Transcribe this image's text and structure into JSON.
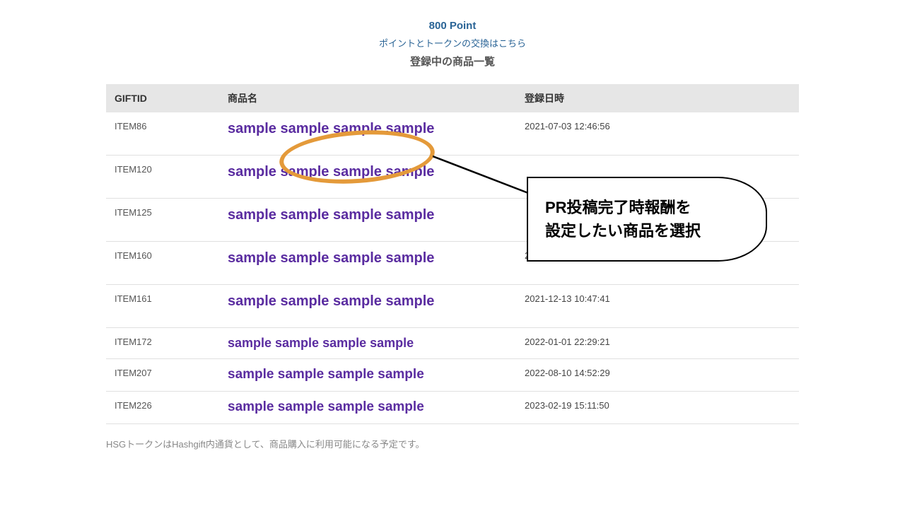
{
  "header": {
    "points_label": "800 Point",
    "exchange_link": "ポイントとトークンの交換はこちら",
    "section_title": "登録中の商品一覧"
  },
  "table": {
    "headers": {
      "id": "GIFTID",
      "name": "商品名",
      "date": "登録日時"
    },
    "rows": [
      {
        "id": "ITEM86",
        "name": "sample sample sample sample",
        "date": "2021-07-03 12:46:56"
      },
      {
        "id": "ITEM120",
        "name": "sample sample sample sample",
        "date": ""
      },
      {
        "id": "ITEM125",
        "name": "sample sample sample sample",
        "date": ""
      },
      {
        "id": "ITEM160",
        "name": "sample sample sample sample",
        "date": "2021-12-"
      },
      {
        "id": "ITEM161",
        "name": "sample sample sample sample",
        "date": "2021-12-13 10:47:41"
      },
      {
        "id": "ITEM172",
        "name": "sample sample sample sample",
        "date": "2022-01-01 22:29:21"
      },
      {
        "id": "ITEM207",
        "name": "sample sample sample sample",
        "date": "2022-08-10 14:52:29"
      },
      {
        "id": "ITEM226",
        "name": "sample sample sample sample",
        "date": "2023-02-19 15:11:50"
      }
    ]
  },
  "footer_note": "HSGトークンはHashgift内通貨として、商品購入に利用可能になる予定です。",
  "callout": {
    "line1": "PR投稿完了時報酬を",
    "line2": "設定したい商品を選択"
  }
}
